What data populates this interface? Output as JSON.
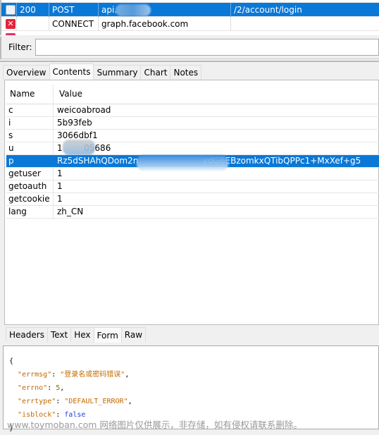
{
  "sequence": {
    "rows": [
      {
        "status": "200",
        "method": "POST",
        "host": "api.",
        "path": "/2/account/login",
        "icon": "json-doc-icon",
        "selected": true
      },
      {
        "status": "",
        "method": "CONNECT",
        "host": "graph.facebook.com",
        "path": "",
        "icon": "error-x-icon",
        "selected": false
      }
    ]
  },
  "filter": {
    "label": "Filter:",
    "value": ""
  },
  "request_tabs": [
    "Overview",
    "Contents",
    "Summary",
    "Chart",
    "Notes"
  ],
  "request_active_tab": "Contents",
  "form_table": {
    "headers": [
      "Name",
      "Value"
    ],
    "rows": [
      {
        "name": "c",
        "value": "weicoabroad"
      },
      {
        "name": "i",
        "value": "5b93feb"
      },
      {
        "name": "s",
        "value": "3066dbf1"
      },
      {
        "name": "u",
        "value": "1        05686"
      },
      {
        "name": "p",
        "value": "Rz5dSHAhQDom2n                        vdG6EBzomkxQTibQPPc1+MxXef+g5"
      },
      {
        "name": "getuser",
        "value": "1"
      },
      {
        "name": "getoauth",
        "value": "1"
      },
      {
        "name": "getcookie",
        "value": "1"
      },
      {
        "name": "lang",
        "value": "zh_CN"
      }
    ]
  },
  "body_tabs": [
    "Headers",
    "Text",
    "Hex",
    "Form",
    "Raw"
  ],
  "body_active_tab": "Form",
  "response": {
    "open": "{",
    "errmsg_key": "\"errmsg\"",
    "errmsg_val": "\"登录名或密码错误\"",
    "errno_key": "\"errno\"",
    "errno_val": "5",
    "errtype_key": "\"errtype\"",
    "errtype_val": "\"DEFAULT_ERROR\"",
    "isblock_key": "\"isblock\"",
    "isblock_val": "false",
    "close": "}"
  },
  "watermark": "www.toymoban.com 网络图片仅供展示，非存储，如有侵权请联系删除。",
  "colors": {
    "selection": "#0a78d7",
    "json_string": "#c26a00",
    "json_bool": "#1f3fd6"
  }
}
